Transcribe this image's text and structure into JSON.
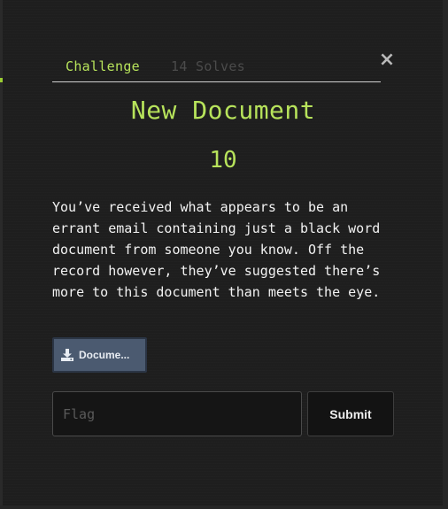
{
  "tabs": {
    "challenge_label": "Challenge",
    "solves_label": "14 Solves"
  },
  "close_icon": "close-icon",
  "challenge": {
    "title": "New Document",
    "points": "10",
    "description": "You’ve received what appears to be an errant email containing just a black word document from someone you know. Off the record however, they’ve suggested there’s more to this document than meets the eye."
  },
  "file": {
    "label": "Docume...",
    "icon": "download-icon"
  },
  "flag": {
    "placeholder": "Flag",
    "value": ""
  },
  "submit": {
    "label": "Submit"
  },
  "colors": {
    "accent": "#b7e35b",
    "background": "#1e1e1e",
    "file_button": "#4b5a70",
    "muted_tab": "#4b4b4b"
  }
}
